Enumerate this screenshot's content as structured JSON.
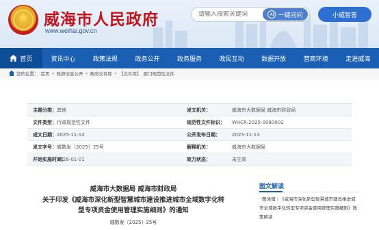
{
  "header": {
    "site_title": "威海市人民政府",
    "site_domain": "www.weihai.gov.cn",
    "search_placeholder": "请输入搜索关键词",
    "ask_button": "一键问问",
    "ask_icon": "AI",
    "assistant_button": "小威智答"
  },
  "nav": {
    "items": [
      "首页",
      "资讯中心",
      "政策法规",
      "政务公开",
      "政务服务",
      "政民互动",
      "数据开放",
      "营商环境",
      "走进威海"
    ]
  },
  "breadcrumb": {
    "prefix": "您的位置：",
    "items": [
      "首页",
      "政府信息公开",
      "政府文件库",
      "【文件库】",
      "部门规范性文件"
    ]
  },
  "meta": {
    "rows": [
      {
        "k1": "主题分类：",
        "v1": "其他",
        "k2": "发文机关：",
        "v2": "威海市大数据局 威海市财政局"
      },
      {
        "k1": "文件类型：",
        "v1": "行政规范性文件",
        "k2": "规范性文件标识：",
        "v2": "WHCR-2025-0080002"
      },
      {
        "k1": "成文日期：",
        "v1": "2025-11-12",
        "k2": "公开发布日期：",
        "v2": "2025-11-13"
      },
      {
        "k1": "发文字号：",
        "v1": "威数发〔2025〕25号",
        "k2": "解释机关：",
        "v2": "威海市大数据局"
      },
      {
        "k1": "开始实施时间：",
        "v1": "2026-01-01",
        "k2": "效力状态：",
        "v2": "未生效"
      }
    ]
  },
  "document": {
    "title_line1": "威海市大数据局 威海市财政局",
    "title_line2": "关于印发《威海市深化新型智慧城市建设推进城市全域数字化转",
    "title_line3": "型专项资金使用管理实施细则》的通知",
    "number": "威数发〔2025〕25号"
  },
  "side": {
    "title": "图文解读",
    "text": "· 图读懂｜《威海市深化新型智慧城市建设推进城市全域数字化转型专项资金使用管理实施细则》政策解读"
  },
  "colors": {
    "brand_red": "#c4161c",
    "nav_blue": "#1a5fb4"
  }
}
